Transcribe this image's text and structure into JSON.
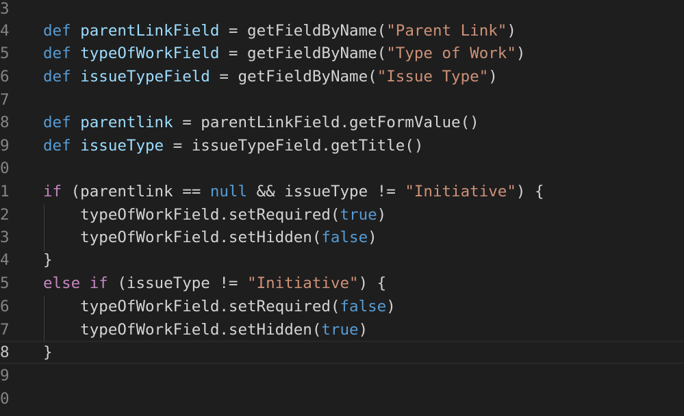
{
  "editor": {
    "line_numbers": [
      "3",
      "4",
      "5",
      "6",
      "7",
      "8",
      "9",
      "0",
      "1",
      "2",
      "3",
      "4",
      "5",
      "6",
      "7",
      "8",
      "9",
      "0"
    ],
    "current_line_index": 15
  },
  "code": {
    "l4": {
      "kw": "def",
      "var": "parentLinkField",
      "rest": " = getFieldByName(",
      "str": "\"Parent Link\"",
      "end": ")"
    },
    "l5": {
      "kw": "def",
      "var": "typeOfWorkField",
      "rest": " = getFieldByName(",
      "str": "\"Type of Work\"",
      "end": ")"
    },
    "l6": {
      "kw": "def",
      "var": "issueTypeField",
      "rest": " = getFieldByName(",
      "str": "\"Issue Type\"",
      "end": ")"
    },
    "l8": {
      "kw": "def",
      "var": "parentlink",
      "rest": " = parentLinkField.getFormValue()"
    },
    "l9": {
      "kw": "def",
      "var": "issueType",
      "rest": " = issueTypeField.getTitle()"
    },
    "l11": {
      "ctl": "if",
      "a": " (parentlink == ",
      "kw": "null",
      "b": " && issueType != ",
      "str": "\"Initiative\"",
      "end": ") {"
    },
    "l12": {
      "a": "    typeOfWorkField.setRequired(",
      "kw": "true",
      "end": ")"
    },
    "l13": {
      "a": "    typeOfWorkField.setHidden(",
      "kw": "false",
      "end": ")"
    },
    "l14": {
      "a": "}"
    },
    "l15": {
      "ctl1": "else",
      "sp": " ",
      "ctl2": "if",
      "a": " (issueType != ",
      "str": "\"Initiative\"",
      "end": ") {"
    },
    "l16": {
      "a": "    typeOfWorkField.setRequired(",
      "kw": "false",
      "end": ")"
    },
    "l17": {
      "a": "    typeOfWorkField.setHidden(",
      "kw": "true",
      "end": ")"
    },
    "l18": {
      "a": "}"
    }
  },
  "colors": {
    "background": "#1e1e1e",
    "keyword": "#569cd6",
    "control": "#c586c0",
    "variable": "#9cdcfe",
    "string": "#ce9178",
    "text": "#d4d4d4",
    "line_number": "#858585"
  }
}
